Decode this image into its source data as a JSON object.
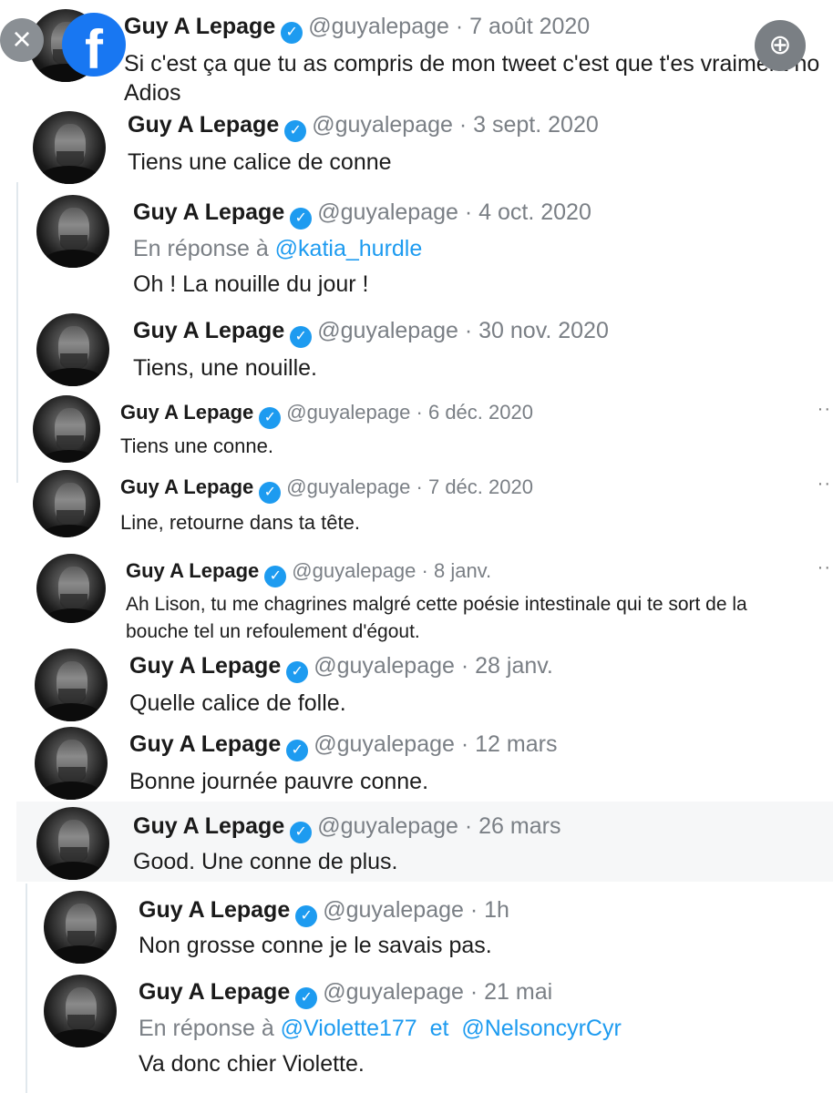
{
  "overlay": {
    "close_icon": "×",
    "zoom_icon": "⊕",
    "facebook_logo": "f"
  },
  "tweets": [
    {
      "name": "Guy A Lepage",
      "handle": "@guyalepage",
      "date": "· 7 août 2020",
      "text": "Si c'est ça que tu as compris de mon tweet c'est que t'es vraiment no",
      "text2": "Adios"
    },
    {
      "name": "Guy A Lepage",
      "handle": "@guyalepage",
      "date": "· 3 sept. 2020",
      "text": "Tiens une calice de conne"
    },
    {
      "name": "Guy A Lepage",
      "handle": "@guyalepage",
      "date": "· 4 oct. 2020",
      "reply_prefix": "En réponse à",
      "reply_to": "@katia_hurdle",
      "text": "Oh ! La nouille du jour !"
    },
    {
      "name": "Guy A Lepage",
      "handle": "@guyalepage",
      "date": "· 30 nov. 2020",
      "text": "Tiens, une nouille."
    },
    {
      "name": "Guy A Lepage",
      "handle": "@guyalepage",
      "date": "· 6 déc. 2020",
      "text": "Tiens une conne.",
      "more": "··"
    },
    {
      "name": "Guy A Lepage",
      "handle": "@guyalepage",
      "date": "· 7 déc. 2020",
      "text": "Line, retourne dans ta tête.",
      "more": "··"
    },
    {
      "name": "Guy A Lepage",
      "handle": "@guyalepage",
      "date": "· 8 janv.",
      "text": "Ah Lison, tu me chagrines malgré cette poésie intestinale qui te sort de la",
      "text2": "bouche tel un refoulement d'égout.",
      "more": "··"
    },
    {
      "name": "Guy A Lepage",
      "handle": "@guyalepage",
      "date": "· 28 janv.",
      "text": "Quelle calice de folle."
    },
    {
      "name": "Guy A Lepage",
      "handle": "@guyalepage",
      "date": "· 12 mars",
      "text": "Bonne journée pauvre conne."
    },
    {
      "name": "Guy A Lepage",
      "handle": "@guyalepage",
      "date": "· 26 mars",
      "text": "Good. Une conne de plus."
    },
    {
      "name": "Guy A Lepage",
      "handle": "@guyalepage",
      "date": "· 1h",
      "text": "Non grosse conne je le savais pas."
    },
    {
      "name": "Guy A Lepage",
      "handle": "@guyalepage",
      "date": "· 21 mai",
      "reply_prefix": "En réponse à",
      "reply_to": "@Violette177",
      "reply_and": "et",
      "reply_to2": "@NelsoncyrCyr",
      "text": "Va donc chier Violette."
    }
  ]
}
